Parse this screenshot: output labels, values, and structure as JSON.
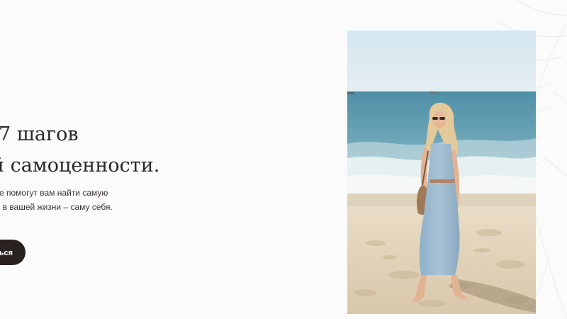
{
  "hero": {
    "heading_line1": "7 шагов",
    "heading_line2": "й самоценности.",
    "description_line1": "е помогут вам найти самую",
    "description_line2": "ь в вашей жизни – саму себя.",
    "cta_label": "ься"
  },
  "colors": {
    "background": "#fbfbfb",
    "text_dark": "#2b2624",
    "button_bg": "#2a2220",
    "button_text": "#ffffff"
  },
  "icons": {
    "decoration": "palm-leaf-icon"
  }
}
